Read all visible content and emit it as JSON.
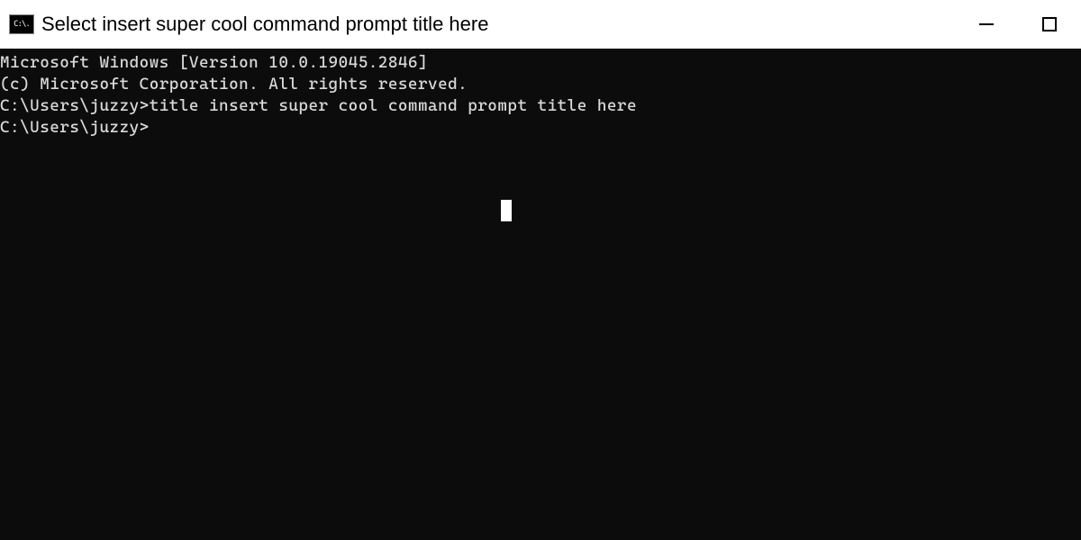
{
  "titlebar": {
    "icon_text": "C:\\.",
    "title": "Select insert super cool command prompt title here"
  },
  "terminal": {
    "lines": [
      "Microsoft Windows [Version 10.0.19045.2846]",
      "(c) Microsoft Corporation. All rights reserved.",
      "",
      "C:\\Users\\juzzy>title insert super cool command prompt title here",
      "",
      "C:\\Users\\juzzy>"
    ]
  }
}
